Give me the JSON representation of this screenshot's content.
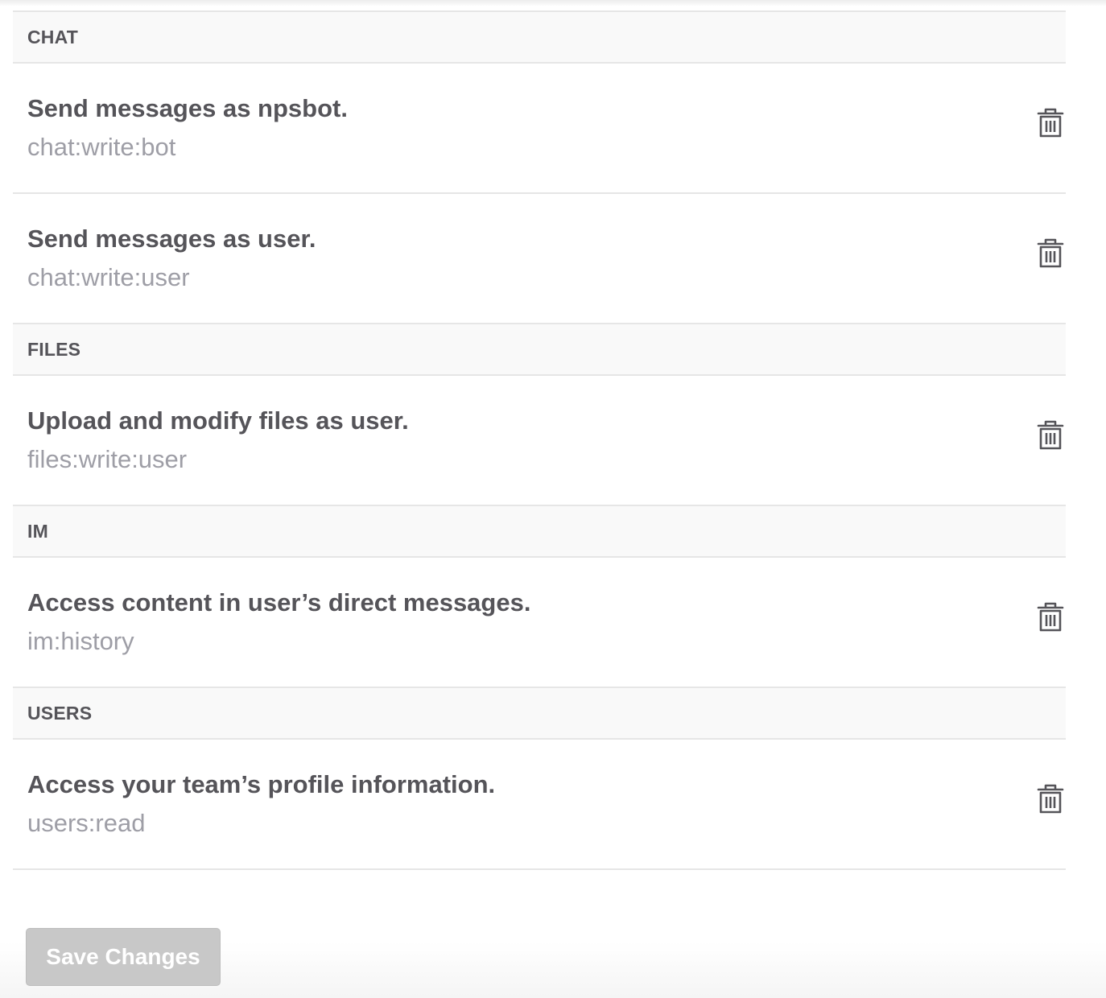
{
  "sections": [
    {
      "header": "CHAT",
      "scopes": [
        {
          "title": "Send messages as npsbot.",
          "code": "chat:write:bot"
        },
        {
          "title": "Send messages as user.",
          "code": "chat:write:user"
        }
      ]
    },
    {
      "header": "FILES",
      "scopes": [
        {
          "title": "Upload and modify files as user.",
          "code": "files:write:user"
        }
      ]
    },
    {
      "header": "IM",
      "scopes": [
        {
          "title": "Access content in user’s direct messages.",
          "code": "im:history"
        }
      ]
    },
    {
      "header": "USERS",
      "scopes": [
        {
          "title": "Access your team’s profile information.",
          "code": "users:read"
        }
      ]
    }
  ],
  "icons": {
    "remove": "trash-icon"
  },
  "colors": {
    "title": "#555459",
    "code": "#9e9ea6",
    "button_disabled": "#c8c8c8"
  },
  "save_button": {
    "label": "Save Changes",
    "state": "disabled"
  }
}
